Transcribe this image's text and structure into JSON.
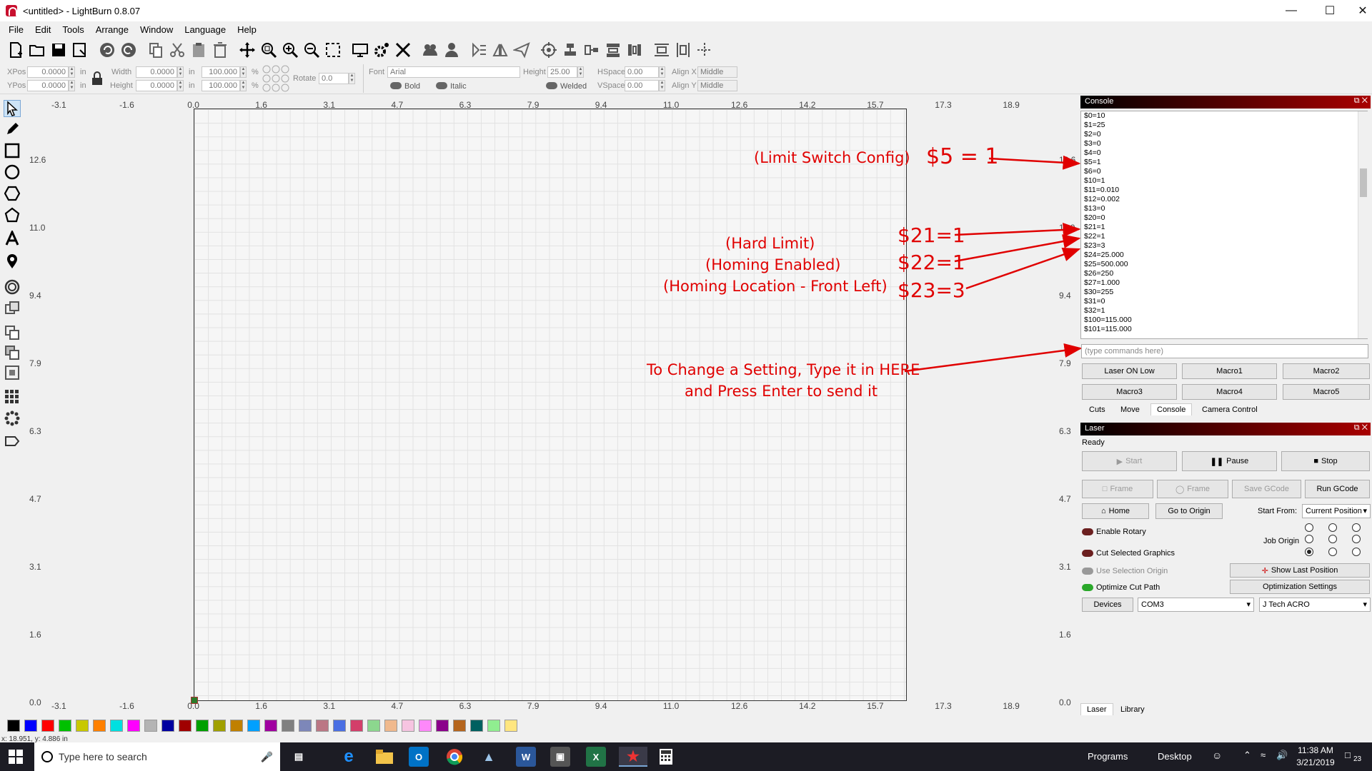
{
  "window": {
    "title": "<untitled> - LightBurn 0.8.07"
  },
  "menu": [
    "File",
    "Edit",
    "Tools",
    "Arrange",
    "Window",
    "Language",
    "Help"
  ],
  "toolbar": {
    "icons": [
      "new-file-icon",
      "open-file-icon",
      "save-icon",
      "save-as-icon",
      "undo-icon",
      "redo-icon",
      "copy-icon",
      "cut-icon",
      "paste-icon",
      "delete-icon",
      "move-icon",
      "zoom-fit-icon",
      "zoom-in-icon",
      "zoom-out-icon",
      "select-frame-icon",
      "device-icon",
      "settings-icon",
      "tools-icon",
      "group-icon",
      "ungroup-icon",
      "mirror-h-icon",
      "mirror-v-icon",
      "send-icon",
      "center-icon",
      "align-icon",
      "distribute-icon",
      "align2-icon",
      "distribute2-icon",
      "spacing-icon",
      "spacing2-icon",
      "cross-icon"
    ]
  },
  "props": {
    "xpos_label": "XPos",
    "xpos": "0.0000",
    "ypos_label": "YPos",
    "ypos": "0.0000",
    "unit": "in",
    "width_label": "Width",
    "width": "0.0000",
    "height_label": "Height",
    "height": "0.0000",
    "scale_w": "100.000",
    "scale_h": "100.000",
    "pct": "%",
    "rotate_label": "Rotate",
    "rotate": "0.0",
    "font_label": "Font",
    "font": "Arial",
    "fheight_label": "Height",
    "fheight": "25.00",
    "hspace_label": "HSpace",
    "hspace": "0.00",
    "vspace_label": "VSpace",
    "vspace": "0.00",
    "alignx_label": "Align X",
    "alignx": "Middle",
    "aligny_label": "Align Y",
    "aligny": "Middle",
    "bold": "Bold",
    "italic": "Italic",
    "welded": "Welded"
  },
  "ruler": {
    "top": [
      "-3.1",
      "-1.6",
      "0.0",
      "1.6",
      "3.1",
      "4.7",
      "6.3",
      "7.9",
      "9.4",
      "11.0",
      "12.6",
      "14.2",
      "15.7",
      "17.3",
      "18.9"
    ],
    "left": [
      "12.6",
      "11.0",
      "9.4",
      "7.9",
      "6.3",
      "4.7",
      "3.1",
      "1.6",
      "0.0"
    ],
    "right": [
      "12.6",
      "11.0",
      "9.4",
      "7.9",
      "6.3",
      "4.7",
      "3.1",
      "1.6",
      "0.0"
    ]
  },
  "annotations": {
    "limit_switch": "(Limit Switch Config)",
    "s5": "$5 = 1",
    "hard_limit": "(Hard Limit)",
    "homing_enabled": "(Homing Enabled)",
    "homing_location": "(Homing Location - Front Left)",
    "s21": "$21=1",
    "s22": "$22=1",
    "s23": "$23=3",
    "change_line1": "To Change a Setting, Type it in HERE",
    "change_line2": "and Press Enter to send it"
  },
  "console": {
    "title": "Console",
    "lines": [
      "$0=10",
      "$1=25",
      "$2=0",
      "$3=0",
      "$4=0",
      "$5=1",
      "$6=0",
      "$10=1",
      "$11=0.010",
      "$12=0.002",
      "$13=0",
      "$20=0",
      "$21=1",
      "$22=1",
      "$23=3",
      "$24=25.000",
      "$25=500.000",
      "$26=250",
      "$27=1.000",
      "$30=255",
      "$31=0",
      "$32=1",
      "$100=115.000",
      "$101=115.000"
    ],
    "input_placeholder": "(type commands here)",
    "macros": [
      "Laser ON Low",
      "Macro1",
      "Macro2",
      "Macro3",
      "Macro4",
      "Macro5"
    ],
    "tabs": [
      "Cuts",
      "Move",
      "Console",
      "Camera Control"
    ]
  },
  "laser": {
    "title": "Laser",
    "status": "Ready",
    "start": "Start",
    "pause": "Pause",
    "stop": "Stop",
    "frame1": "Frame",
    "frame2": "Frame",
    "save_gcode": "Save GCode",
    "run_gcode": "Run GCode",
    "home": "Home",
    "go_origin": "Go to Origin",
    "start_from_label": "Start From:",
    "start_from": "Current Position",
    "job_origin": "Job Origin",
    "enable_rotary": "Enable Rotary",
    "cut_selected": "Cut Selected Graphics",
    "use_selection_origin": "Use Selection Origin",
    "optimize_cut": "Optimize Cut Path",
    "show_last": "Show Last Position",
    "opt_settings": "Optimization Settings",
    "devices": "Devices",
    "port": "COM3",
    "device": "J Tech ACRO",
    "tabs": [
      "Laser",
      "Library"
    ]
  },
  "palette": [
    "#000000",
    "#0000ff",
    "#ff0000",
    "#00c000",
    "#c8c800",
    "#ff8000",
    "#00e0e0",
    "#ff00ff",
    "#b4b4b4",
    "#0000a0",
    "#a00000",
    "#00a000",
    "#a0a000",
    "#c08000",
    "#00a0ff",
    "#a000a0",
    "#808080",
    "#7d87b9",
    "#bb7784",
    "#4a6fe3",
    "#d33f6a",
    "#8cd78e",
    "#f0b98d",
    "#f6c4e1",
    "#fe88fa",
    "#8b008b",
    "#b5651d",
    "#006060",
    "#90ee90",
    "#ffe680"
  ],
  "status": {
    "coords": "x: 18.951, y: 4.886 in"
  },
  "taskbar": {
    "search": "Type here to search",
    "programs": "Programs",
    "desktop": "Desktop",
    "time": "11:38 AM",
    "date": "3/21/2019",
    "notif": "23"
  }
}
